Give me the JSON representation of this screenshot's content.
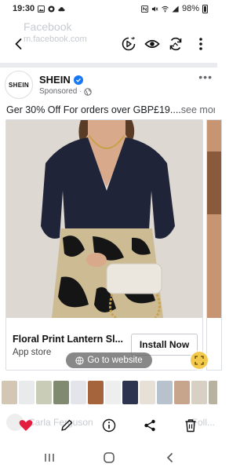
{
  "status_bar": {
    "time": "19:30",
    "battery": "98%"
  },
  "ghost_header": {
    "title": "Facebook",
    "url": "m.facebook.com"
  },
  "toolbar": {
    "back_icon": "arrow-left-icon",
    "icons": [
      "speech-play-icon",
      "eye-icon",
      "refresh-icon",
      "more-vertical-icon"
    ]
  },
  "post": {
    "page_name": "SHEIN",
    "avatar_text": "SHEIN",
    "sponsored_label": "Sponsored",
    "text": "Ger 30% Off For orders over GBP£19....",
    "see_more": "see more"
  },
  "card": {
    "title": "Floral Print Lantern Sl...",
    "subtitle": "App store",
    "cta": "Install Now"
  },
  "go_to_website": "Go to website",
  "ghost_comment": {
    "name": "Carla Ferguson",
    "action": "Foll..."
  },
  "colors": {
    "verified": "#1877f2",
    "heart": "#e41e3f",
    "top": "#1f2438",
    "skirt_base": "#cdbb93"
  }
}
